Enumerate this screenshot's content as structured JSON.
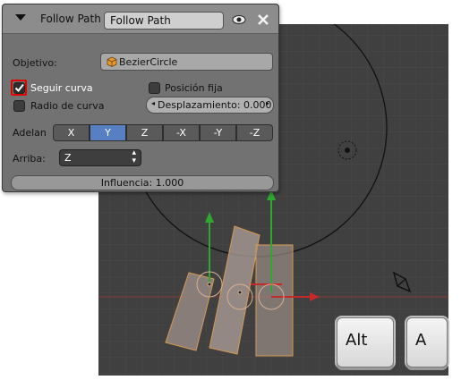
{
  "panel": {
    "title": "Follow Path",
    "name_value": "Follow Path",
    "target_label": "Objetivo:",
    "target_value": "BezierCircle",
    "follow_curve_label": "Seguir curva",
    "follow_curve_checked": true,
    "fixed_position_label": "Posición fija",
    "fixed_position_checked": false,
    "curve_radius_label": "Radio de curva",
    "curve_radius_checked": false,
    "offset_value": "Desplazamiento: 0.000",
    "forward_label": "Adelan",
    "forward_axes": [
      "X",
      "Y",
      "Z",
      "-X",
      "-Y",
      "-Z"
    ],
    "forward_selected": "Y",
    "up_label": "Arriba:",
    "up_value": "Z",
    "influence_value": "Influencia: 1.000"
  },
  "keys": [
    "Alt",
    "A"
  ],
  "icons": [
    "disclosure-triangle-icon",
    "eye-icon",
    "close-icon",
    "object-icon",
    "checkmark-icon",
    "arrow-left-icon",
    "arrow-right-icon",
    "updown-icon",
    "camera-icon",
    "origin-icon"
  ],
  "colors": {
    "panel_bg": "#727272",
    "accent": "#5680c2",
    "viewport_bg": "#404040",
    "highlight": "#e00000"
  }
}
